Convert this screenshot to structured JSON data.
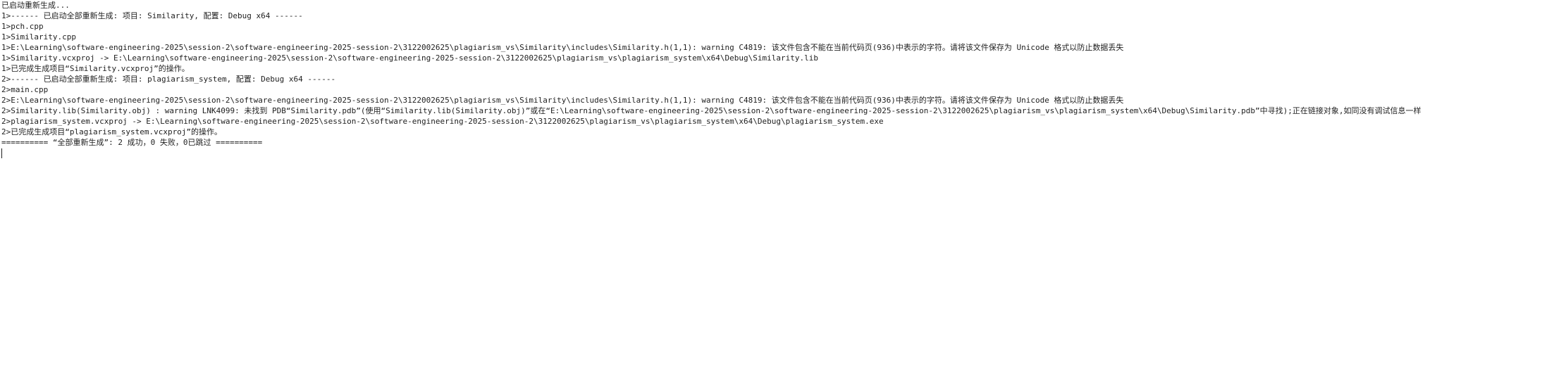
{
  "output": {
    "lines": [
      "已启动重新生成...",
      "1>------ 已启动全部重新生成: 项目: Similarity, 配置: Debug x64 ------",
      "1>pch.cpp",
      "1>Similarity.cpp",
      "1>E:\\Learning\\software-engineering-2025\\session-2\\software-engineering-2025-session-2\\3122002625\\plagiarism_vs\\Similarity\\includes\\Similarity.h(1,1): warning C4819: 该文件包含不能在当前代码页(936)中表示的字符。请将该文件保存为 Unicode 格式以防止数据丢失",
      "1>Similarity.vcxproj -> E:\\Learning\\software-engineering-2025\\session-2\\software-engineering-2025-session-2\\3122002625\\plagiarism_vs\\plagiarism_system\\x64\\Debug\\Similarity.lib",
      "1>已完成生成项目“Similarity.vcxproj”的操作。",
      "2>------ 已启动全部重新生成: 项目: plagiarism_system, 配置: Debug x64 ------",
      "2>main.cpp",
      "2>E:\\Learning\\software-engineering-2025\\session-2\\software-engineering-2025-session-2\\3122002625\\plagiarism_vs\\Similarity\\includes\\Similarity.h(1,1): warning C4819: 该文件包含不能在当前代码页(936)中表示的字符。请将该文件保存为 Unicode 格式以防止数据丢失",
      "2>Similarity.lib(Similarity.obj) : warning LNK4099: 未找到 PDB“Similarity.pdb”(使用“Similarity.lib(Similarity.obj)”或在“E:\\Learning\\software-engineering-2025\\session-2\\software-engineering-2025-session-2\\3122002625\\plagiarism_vs\\plagiarism_system\\x64\\Debug\\Similarity.pdb”中寻找);正在链接对象,如同没有调试信息一样",
      "2>plagiarism_system.vcxproj -> E:\\Learning\\software-engineering-2025\\session-2\\software-engineering-2025-session-2\\3122002625\\plagiarism_vs\\plagiarism_system\\x64\\Debug\\plagiarism_system.exe",
      "2>已完成生成项目“plagiarism_system.vcxproj”的操作。",
      "========== “全部重新生成”: 2 成功，0 失败，0已跳过 =========="
    ]
  }
}
